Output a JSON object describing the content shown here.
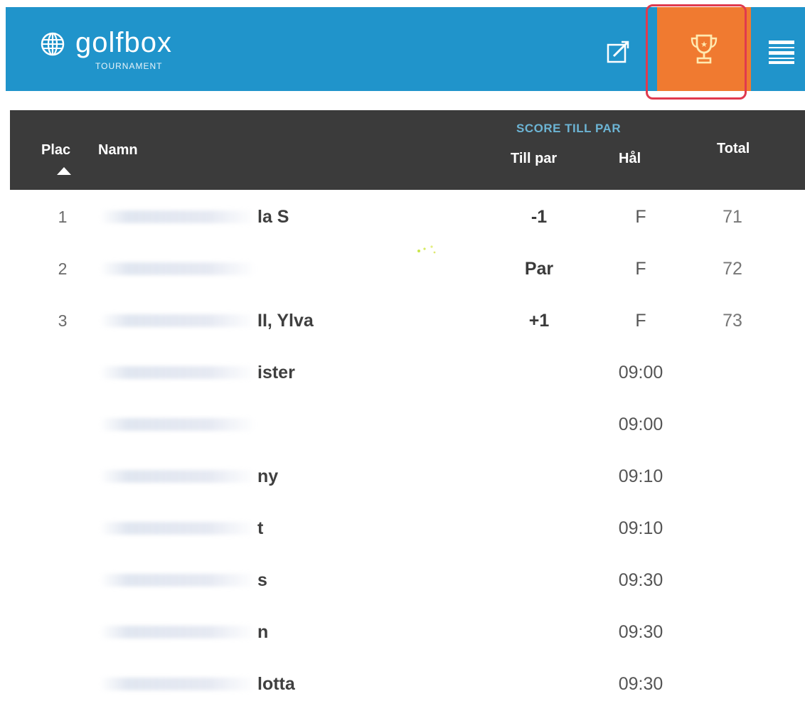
{
  "header": {
    "brand_name": "golfbox",
    "brand_sub": "TOURNAMENT",
    "colors": {
      "bar": "#2094cb",
      "active_tab": "#f07a30",
      "highlight": "#e03a4e"
    },
    "icons": [
      "globe-icon",
      "edit-icon",
      "trophy-icon",
      "hamburger-menu-icon"
    ]
  },
  "table": {
    "columns": {
      "plac": "Plac",
      "namn": "Namn",
      "group": "SCORE TILL PAR",
      "tillpar": "Till par",
      "hal": "Hål",
      "total": "Total"
    },
    "ranked": [
      {
        "plac": "1",
        "name": "la S",
        "tillpar": "-1",
        "hal": "F",
        "total": "71"
      },
      {
        "plac": "2",
        "name": "",
        "tillpar": "Par",
        "hal": "F",
        "total": "72"
      },
      {
        "plac": "3",
        "name": "II, Ylva",
        "tillpar": "+1",
        "hal": "F",
        "total": "73"
      }
    ],
    "upcoming": [
      {
        "name": "ister",
        "time": "09:00"
      },
      {
        "name": "",
        "time": "09:00"
      },
      {
        "name": "ny",
        "time": "09:10"
      },
      {
        "name": "t",
        "time": "09:10"
      },
      {
        "name": "s",
        "time": "09:30"
      },
      {
        "name": "n",
        "time": "09:30"
      },
      {
        "name": "lotta",
        "time": "09:30"
      }
    ]
  }
}
